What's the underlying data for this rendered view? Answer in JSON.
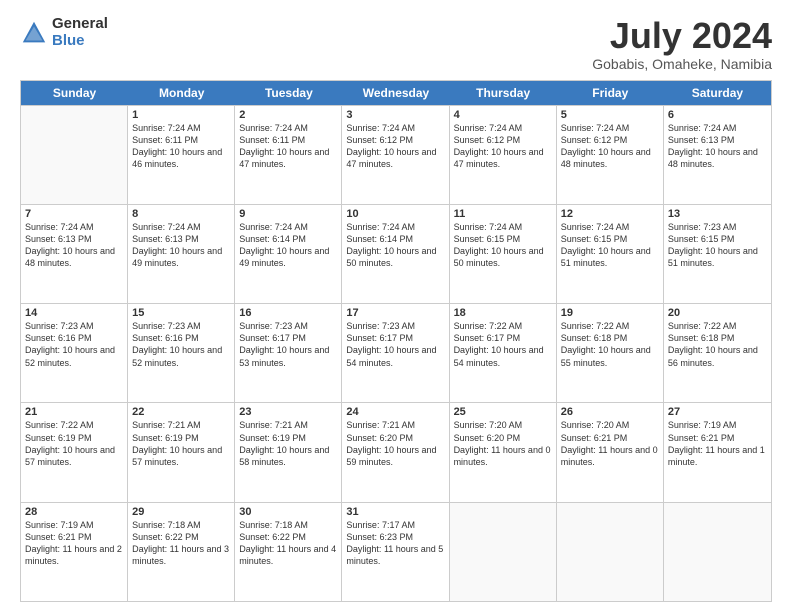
{
  "logo": {
    "general": "General",
    "blue": "Blue"
  },
  "title": "July 2024",
  "location": "Gobabis, Omaheke, Namibia",
  "days_of_week": [
    "Sunday",
    "Monday",
    "Tuesday",
    "Wednesday",
    "Thursday",
    "Friday",
    "Saturday"
  ],
  "weeks": [
    [
      {
        "day": "",
        "empty": true
      },
      {
        "day": "1",
        "sunrise": "Sunrise: 7:24 AM",
        "sunset": "Sunset: 6:11 PM",
        "daylight": "Daylight: 10 hours and 46 minutes."
      },
      {
        "day": "2",
        "sunrise": "Sunrise: 7:24 AM",
        "sunset": "Sunset: 6:11 PM",
        "daylight": "Daylight: 10 hours and 47 minutes."
      },
      {
        "day": "3",
        "sunrise": "Sunrise: 7:24 AM",
        "sunset": "Sunset: 6:12 PM",
        "daylight": "Daylight: 10 hours and 47 minutes."
      },
      {
        "day": "4",
        "sunrise": "Sunrise: 7:24 AM",
        "sunset": "Sunset: 6:12 PM",
        "daylight": "Daylight: 10 hours and 47 minutes."
      },
      {
        "day": "5",
        "sunrise": "Sunrise: 7:24 AM",
        "sunset": "Sunset: 6:12 PM",
        "daylight": "Daylight: 10 hours and 48 minutes."
      },
      {
        "day": "6",
        "sunrise": "Sunrise: 7:24 AM",
        "sunset": "Sunset: 6:13 PM",
        "daylight": "Daylight: 10 hours and 48 minutes."
      }
    ],
    [
      {
        "day": "7",
        "sunrise": "Sunrise: 7:24 AM",
        "sunset": "Sunset: 6:13 PM",
        "daylight": "Daylight: 10 hours and 48 minutes."
      },
      {
        "day": "8",
        "sunrise": "Sunrise: 7:24 AM",
        "sunset": "Sunset: 6:13 PM",
        "daylight": "Daylight: 10 hours and 49 minutes."
      },
      {
        "day": "9",
        "sunrise": "Sunrise: 7:24 AM",
        "sunset": "Sunset: 6:14 PM",
        "daylight": "Daylight: 10 hours and 49 minutes."
      },
      {
        "day": "10",
        "sunrise": "Sunrise: 7:24 AM",
        "sunset": "Sunset: 6:14 PM",
        "daylight": "Daylight: 10 hours and 50 minutes."
      },
      {
        "day": "11",
        "sunrise": "Sunrise: 7:24 AM",
        "sunset": "Sunset: 6:15 PM",
        "daylight": "Daylight: 10 hours and 50 minutes."
      },
      {
        "day": "12",
        "sunrise": "Sunrise: 7:24 AM",
        "sunset": "Sunset: 6:15 PM",
        "daylight": "Daylight: 10 hours and 51 minutes."
      },
      {
        "day": "13",
        "sunrise": "Sunrise: 7:23 AM",
        "sunset": "Sunset: 6:15 PM",
        "daylight": "Daylight: 10 hours and 51 minutes."
      }
    ],
    [
      {
        "day": "14",
        "sunrise": "Sunrise: 7:23 AM",
        "sunset": "Sunset: 6:16 PM",
        "daylight": "Daylight: 10 hours and 52 minutes."
      },
      {
        "day": "15",
        "sunrise": "Sunrise: 7:23 AM",
        "sunset": "Sunset: 6:16 PM",
        "daylight": "Daylight: 10 hours and 52 minutes."
      },
      {
        "day": "16",
        "sunrise": "Sunrise: 7:23 AM",
        "sunset": "Sunset: 6:17 PM",
        "daylight": "Daylight: 10 hours and 53 minutes."
      },
      {
        "day": "17",
        "sunrise": "Sunrise: 7:23 AM",
        "sunset": "Sunset: 6:17 PM",
        "daylight": "Daylight: 10 hours and 54 minutes."
      },
      {
        "day": "18",
        "sunrise": "Sunrise: 7:22 AM",
        "sunset": "Sunset: 6:17 PM",
        "daylight": "Daylight: 10 hours and 54 minutes."
      },
      {
        "day": "19",
        "sunrise": "Sunrise: 7:22 AM",
        "sunset": "Sunset: 6:18 PM",
        "daylight": "Daylight: 10 hours and 55 minutes."
      },
      {
        "day": "20",
        "sunrise": "Sunrise: 7:22 AM",
        "sunset": "Sunset: 6:18 PM",
        "daylight": "Daylight: 10 hours and 56 minutes."
      }
    ],
    [
      {
        "day": "21",
        "sunrise": "Sunrise: 7:22 AM",
        "sunset": "Sunset: 6:19 PM",
        "daylight": "Daylight: 10 hours and 57 minutes."
      },
      {
        "day": "22",
        "sunrise": "Sunrise: 7:21 AM",
        "sunset": "Sunset: 6:19 PM",
        "daylight": "Daylight: 10 hours and 57 minutes."
      },
      {
        "day": "23",
        "sunrise": "Sunrise: 7:21 AM",
        "sunset": "Sunset: 6:19 PM",
        "daylight": "Daylight: 10 hours and 58 minutes."
      },
      {
        "day": "24",
        "sunrise": "Sunrise: 7:21 AM",
        "sunset": "Sunset: 6:20 PM",
        "daylight": "Daylight: 10 hours and 59 minutes."
      },
      {
        "day": "25",
        "sunrise": "Sunrise: 7:20 AM",
        "sunset": "Sunset: 6:20 PM",
        "daylight": "Daylight: 11 hours and 0 minutes."
      },
      {
        "day": "26",
        "sunrise": "Sunrise: 7:20 AM",
        "sunset": "Sunset: 6:21 PM",
        "daylight": "Daylight: 11 hours and 0 minutes."
      },
      {
        "day": "27",
        "sunrise": "Sunrise: 7:19 AM",
        "sunset": "Sunset: 6:21 PM",
        "daylight": "Daylight: 11 hours and 1 minute."
      }
    ],
    [
      {
        "day": "28",
        "sunrise": "Sunrise: 7:19 AM",
        "sunset": "Sunset: 6:21 PM",
        "daylight": "Daylight: 11 hours and 2 minutes."
      },
      {
        "day": "29",
        "sunrise": "Sunrise: 7:18 AM",
        "sunset": "Sunset: 6:22 PM",
        "daylight": "Daylight: 11 hours and 3 minutes."
      },
      {
        "day": "30",
        "sunrise": "Sunrise: 7:18 AM",
        "sunset": "Sunset: 6:22 PM",
        "daylight": "Daylight: 11 hours and 4 minutes."
      },
      {
        "day": "31",
        "sunrise": "Sunrise: 7:17 AM",
        "sunset": "Sunset: 6:23 PM",
        "daylight": "Daylight: 11 hours and 5 minutes."
      },
      {
        "day": "",
        "empty": true
      },
      {
        "day": "",
        "empty": true
      },
      {
        "day": "",
        "empty": true
      }
    ]
  ]
}
